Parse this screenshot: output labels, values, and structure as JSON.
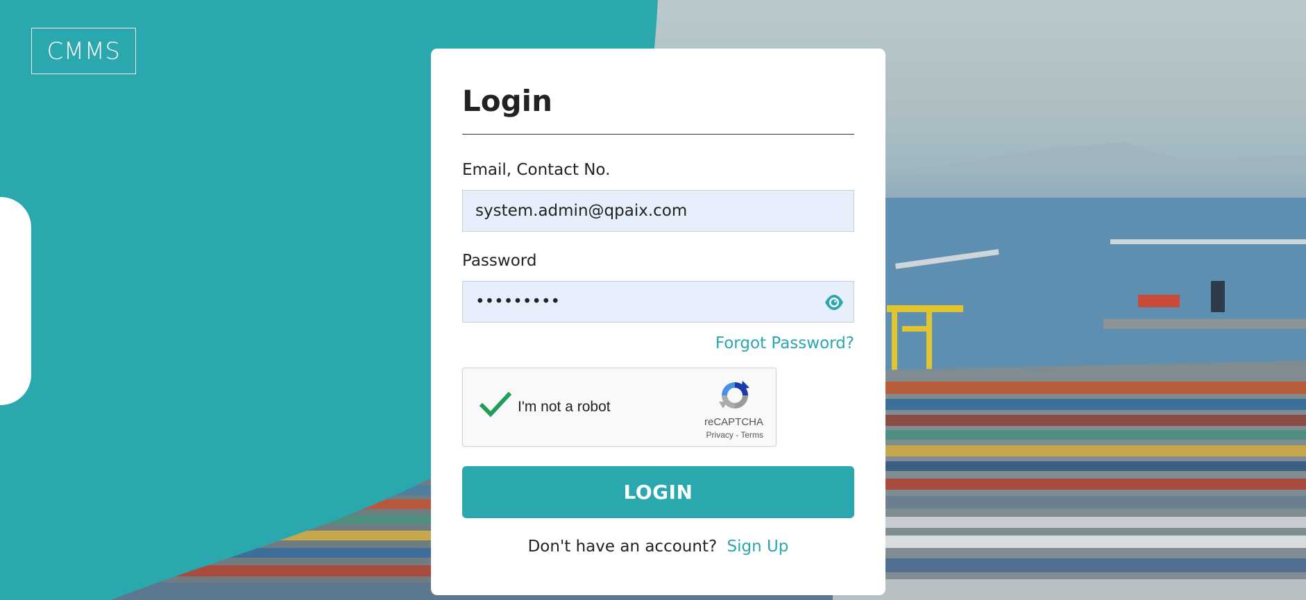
{
  "brand": {
    "logo_text": "CMMS"
  },
  "login": {
    "title": "Login",
    "email_label": "Email, Contact No.",
    "email_value": "system.admin@qpaix.com",
    "password_label": "Password",
    "password_value": "•••••••••",
    "forgot_link": "Forgot Password?",
    "submit_label": "LOGIN",
    "signup_prompt": "Don't have an account?",
    "signup_link": "Sign Up"
  },
  "recaptcha": {
    "label": "I'm not a robot",
    "brand": "reCAPTCHA",
    "privacy": "Privacy",
    "separator": " - ",
    "terms": "Terms",
    "checked": true
  },
  "icons": {
    "eye": "eye-icon",
    "check": "checkmark-icon",
    "recaptcha": "recaptcha-logo-icon"
  },
  "colors": {
    "accent": "#2aa8ad",
    "input_bg": "#e8effc"
  }
}
